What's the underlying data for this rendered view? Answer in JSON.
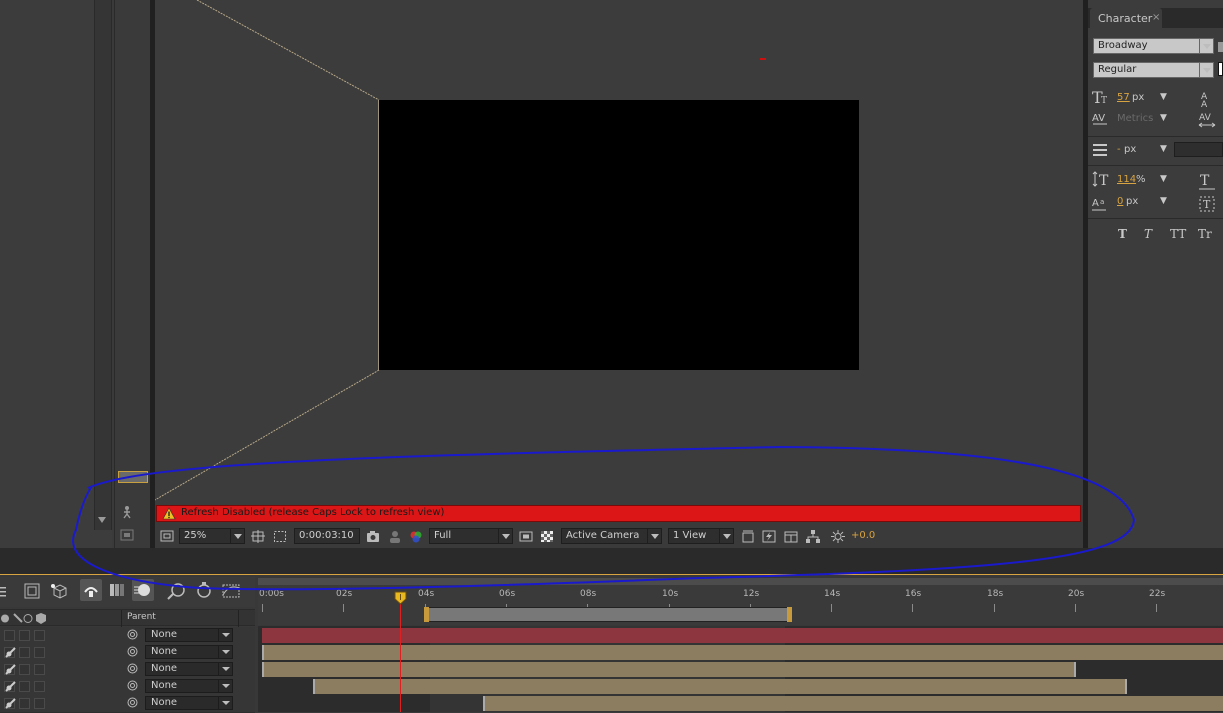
{
  "character_panel": {
    "tab": "Character",
    "font_family": "Broadway",
    "font_style": "Regular",
    "size_value": "57",
    "size_unit": "px",
    "kerning": "Metrics",
    "stroke_value": "-",
    "stroke_unit": "px",
    "vscale_value": "114",
    "vscale_unit": "%",
    "baseline_value": "0",
    "baseline_unit": "px",
    "style_buttons": [
      "T",
      "T",
      "TT",
      "Tr"
    ]
  },
  "viewer": {
    "warning": "Refresh Disabled (release Caps Lock to refresh view)",
    "zoom": "25%",
    "timecode": "0:00:03:10",
    "resolution": "Full",
    "camera": "Active Camera",
    "views": "1 View",
    "exposure": "+0.0"
  },
  "timeline": {
    "parent_header": "Parent",
    "ruler": [
      "0:00s",
      "02s",
      "04s",
      "06s",
      "08s",
      "10s",
      "12s",
      "14s",
      "16s",
      "18s",
      "20s",
      "22s"
    ],
    "layers": [
      {
        "parent": "None"
      },
      {
        "parent": "None"
      },
      {
        "parent": "None"
      },
      {
        "parent": "None"
      },
      {
        "parent": "None"
      }
    ]
  },
  "colors": {
    "warning_bg": "#dc1616",
    "bar_tan": "#8c7c60",
    "bar_red": "#8e3640",
    "accent_orange": "#d8a341",
    "annotation_blue": "#1a1acc"
  }
}
